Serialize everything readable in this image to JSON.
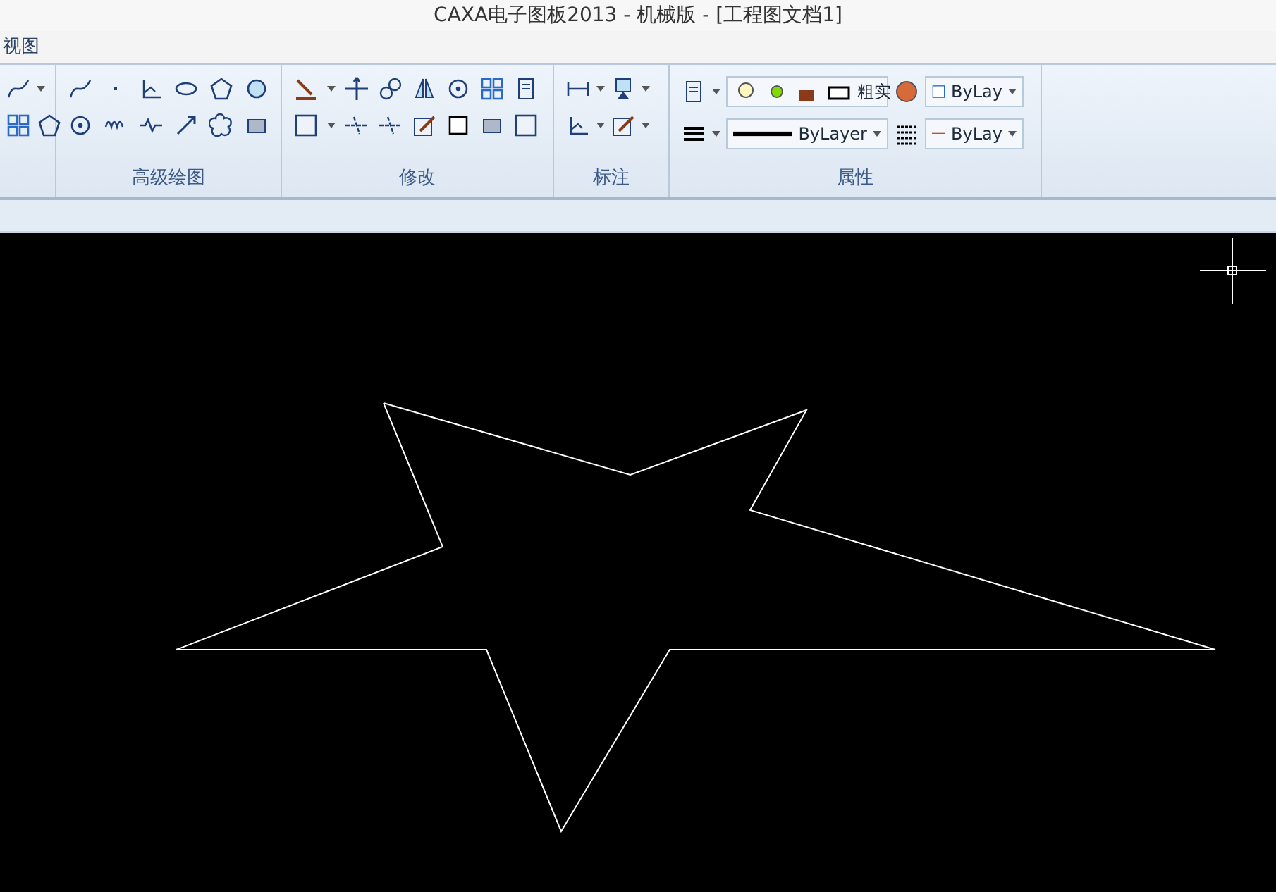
{
  "window": {
    "title": "CAXA电子图板2013 - 机械版 - [工程图文档1]"
  },
  "menu": [
    "视图"
  ],
  "ribbon_groups": [
    {
      "label": "高级绘图"
    },
    {
      "label": "修改"
    },
    {
      "label": "标注"
    },
    {
      "label": "属性"
    }
  ],
  "properties": {
    "layer": "粗实",
    "line_weight": "ByLayer",
    "color_combo": "ByLay",
    "line_type": "ByLay"
  }
}
